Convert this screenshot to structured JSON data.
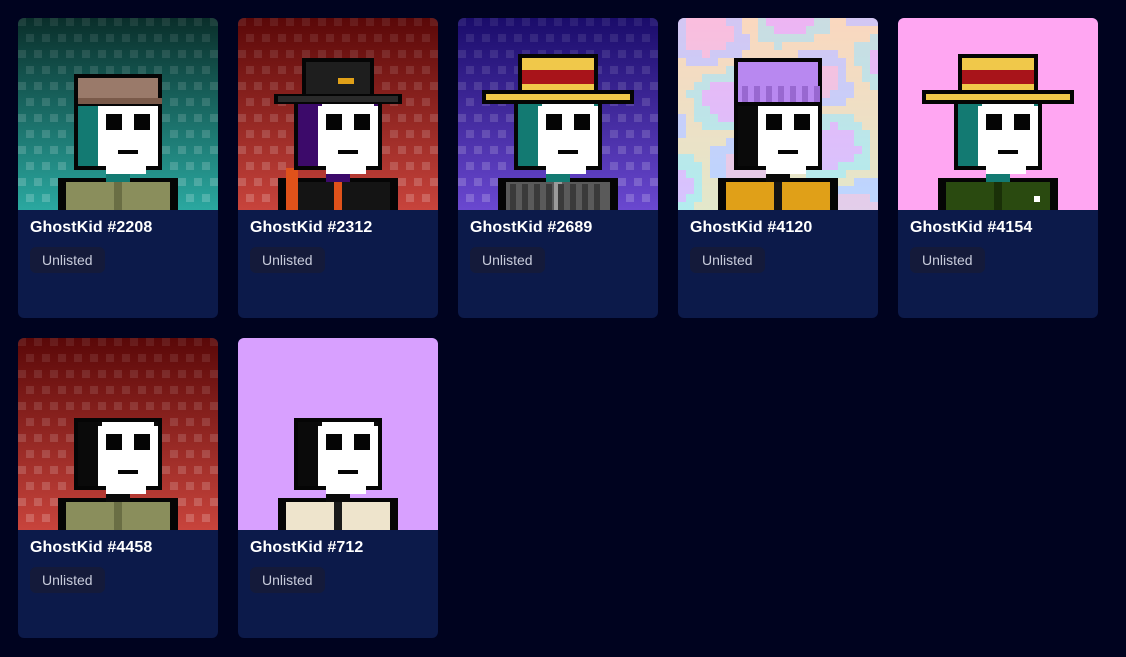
{
  "colors": {
    "page_bg": "#00031f",
    "card_bg": "#0c1a4a",
    "badge_bg": "#141a3a"
  },
  "cards": [
    {
      "name": "GhostKid #2208",
      "status": "Unlisted",
      "bg": "teal",
      "head": "teal",
      "hat": "cap-brown",
      "body": "jacket-olive"
    },
    {
      "name": "GhostKid #2312",
      "status": "Unlisted",
      "bg": "red",
      "head": "purple",
      "hat": "bucket-black",
      "body": "black-orange"
    },
    {
      "name": "GhostKid #2689",
      "status": "Unlisted",
      "bg": "blue",
      "head": "teal",
      "hat": "straw",
      "body": "plaid"
    },
    {
      "name": "GhostKid #4120",
      "status": "Unlisted",
      "bg": "pastel",
      "head": "black",
      "hat": "beanie-purple",
      "body": "black-yellow"
    },
    {
      "name": "GhostKid #4154",
      "status": "Unlisted",
      "bg": "pink",
      "head": "teal",
      "hat": "straw",
      "body": "green-shirt"
    },
    {
      "name": "GhostKid #4458",
      "status": "Unlisted",
      "bg": "red",
      "head": "black",
      "hat": "none",
      "body": "jacket-olive"
    },
    {
      "name": "GhostKid #712",
      "status": "Unlisted",
      "bg": "lavender",
      "head": "black",
      "hat": "none",
      "body": "cream-jacket"
    }
  ]
}
